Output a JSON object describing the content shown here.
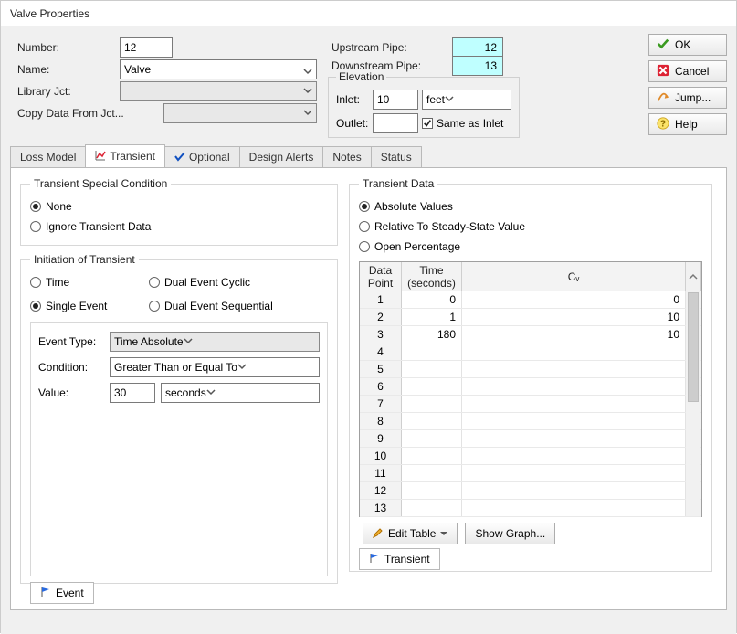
{
  "title": "Valve Properties",
  "top": {
    "number_label": "Number:",
    "number_value": "12",
    "name_label": "Name:",
    "name_value": "Valve",
    "library_label": "Library Jct:",
    "copy_label": "Copy Data From Jct..."
  },
  "pipes": {
    "up_label": "Upstream Pipe:",
    "up_value": "12",
    "down_label": "Downstream Pipe:",
    "down_value": "13"
  },
  "elev": {
    "legend": "Elevation",
    "inlet_label": "Inlet:",
    "inlet_value": "10",
    "inlet_unit": "feet",
    "outlet_label": "Outlet:",
    "same_label": "Same as Inlet"
  },
  "buttons": {
    "ok": "OK",
    "cancel": "Cancel",
    "jump": "Jump...",
    "help": "Help"
  },
  "tabs": [
    "Loss Model",
    "Transient",
    "Optional",
    "Design Alerts",
    "Notes",
    "Status"
  ],
  "tsc": {
    "legend": "Transient Special Condition",
    "none": "None",
    "ignore": "Ignore Transient Data"
  },
  "init": {
    "legend": "Initiation of Transient",
    "time": "Time",
    "dual_cyclic": "Dual Event Cyclic",
    "single": "Single Event",
    "dual_seq": "Dual Event Sequential"
  },
  "evt": {
    "type_label": "Event Type:",
    "type_value": "Time Absolute",
    "cond_label": "Condition:",
    "cond_value": "Greater Than or Equal To",
    "value_label": "Value:",
    "value": "30",
    "value_unit": "seconds",
    "footer": "Event"
  },
  "td": {
    "legend": "Transient Data",
    "abs": "Absolute Values",
    "rel": "Relative To Steady-State Value",
    "open": "Open Percentage",
    "cols": [
      "Data\nPoint",
      "Time\n(seconds)",
      "Cᵥ"
    ],
    "rows": [
      {
        "n": "1",
        "t": "0",
        "cv": "0"
      },
      {
        "n": "2",
        "t": "1",
        "cv": "10"
      },
      {
        "n": "3",
        "t": "180",
        "cv": "10"
      },
      {
        "n": "4",
        "t": "",
        "cv": ""
      },
      {
        "n": "5",
        "t": "",
        "cv": ""
      },
      {
        "n": "6",
        "t": "",
        "cv": ""
      },
      {
        "n": "7",
        "t": "",
        "cv": ""
      },
      {
        "n": "8",
        "t": "",
        "cv": ""
      },
      {
        "n": "9",
        "t": "",
        "cv": ""
      },
      {
        "n": "10",
        "t": "",
        "cv": ""
      },
      {
        "n": "11",
        "t": "",
        "cv": ""
      },
      {
        "n": "12",
        "t": "",
        "cv": ""
      },
      {
        "n": "13",
        "t": "",
        "cv": ""
      }
    ],
    "edit_table": "Edit Table",
    "show_graph": "Show Graph...",
    "footer": "Transient"
  }
}
